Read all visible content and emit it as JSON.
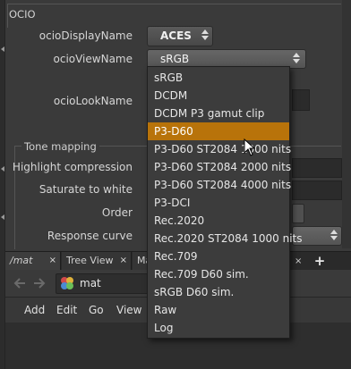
{
  "ocio": {
    "section_title": "OCIO",
    "display_label": "ocioDisplayName",
    "display_value": "ACES",
    "view_label": "ocioViewName",
    "view_value": "sRGB",
    "look_label": "ocioLookName"
  },
  "tonemapping": {
    "section_title": "Tone mapping",
    "labels": [
      "Highlight compression",
      "Saturate to white",
      "Order",
      "Response curve"
    ]
  },
  "dropdown": {
    "selected_index": 3,
    "options": [
      "sRGB",
      "DCDM",
      "DCDM P3 gamut clip",
      "P3-D60",
      "P3-D60 ST2084 1000 nits",
      "P3-D60 ST2084 2000 nits",
      "P3-D60 ST2084 4000 nits",
      "P3-DCI",
      "Rec.2020",
      "Rec.2020 ST2084 1000 nits",
      "Rec.709",
      "Rec.709 D60 sim.",
      "sRGB D60 sim.",
      "Raw",
      "Log"
    ]
  },
  "pane": {
    "tabs": [
      {
        "label": "/mat",
        "close": "×"
      },
      {
        "label": "Tree View",
        "close": "×"
      },
      {
        "label": "Ma",
        "close": ""
      }
    ],
    "tab_close_right": "×",
    "add_tab": "+",
    "path_value": "mat",
    "menu": [
      "Add",
      "Edit",
      "Go",
      "View"
    ]
  },
  "icons": {
    "back": "back-arrow-icon",
    "forward": "forward-arrow-icon",
    "node": "material-network-icon",
    "cursor": "mouse-pointer-icon"
  },
  "colors": {
    "highlight": "#b8730a",
    "background": "#3a3a3a"
  }
}
